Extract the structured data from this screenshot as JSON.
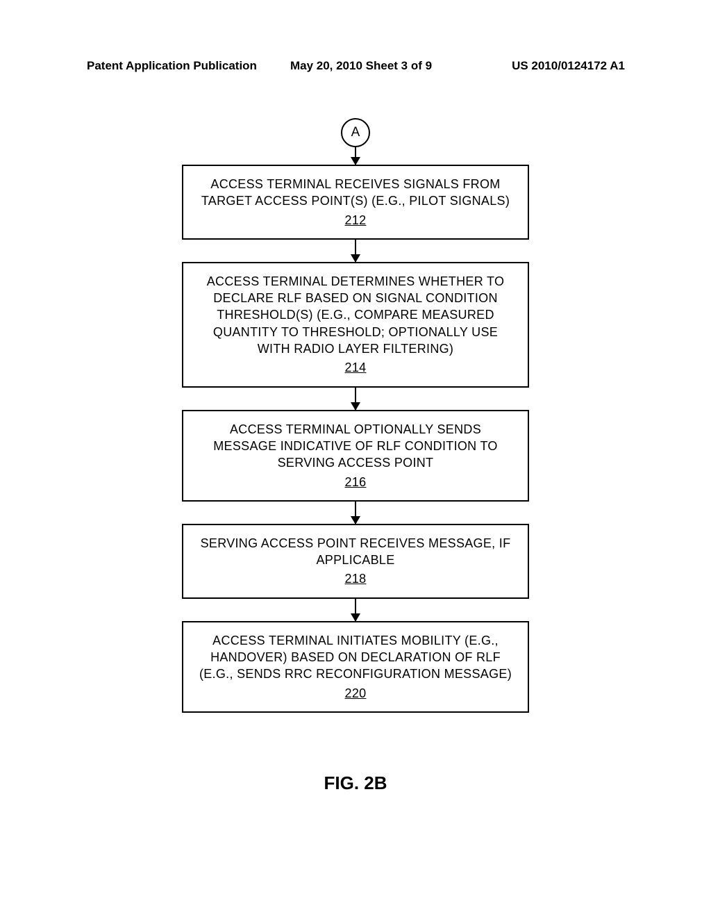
{
  "header": {
    "left": "Patent Application Publication",
    "center": "May 20, 2010  Sheet 3 of 9",
    "right": "US 2010/0124172 A1"
  },
  "connector": "A",
  "boxes": [
    {
      "text": "ACCESS TERMINAL RECEIVES SIGNALS FROM TARGET ACCESS POINT(S) (E.G., PILOT SIGNALS)",
      "ref": "212"
    },
    {
      "text": "ACCESS TERMINAL DETERMINES WHETHER TO DECLARE RLF BASED ON SIGNAL CONDITION THRESHOLD(S) (E.G., COMPARE MEASURED QUANTITY TO THRESHOLD; OPTIONALLY USE WITH RADIO LAYER FILTERING)",
      "ref": "214"
    },
    {
      "text": "ACCESS TERMINAL OPTIONALLY SENDS MESSAGE INDICATIVE OF RLF CONDITION TO SERVING ACCESS POINT",
      "ref": "216"
    },
    {
      "text": "SERVING ACCESS POINT RECEIVES MESSAGE, IF APPLICABLE",
      "ref": "218"
    },
    {
      "text": "ACCESS TERMINAL INITIATES MOBILITY (E.G., HANDOVER) BASED ON DECLARATION OF RLF (E.G., SENDS RRC RECONFIGURATION MESSAGE)",
      "ref": "220"
    }
  ],
  "figure_label": "FIG. 2B"
}
